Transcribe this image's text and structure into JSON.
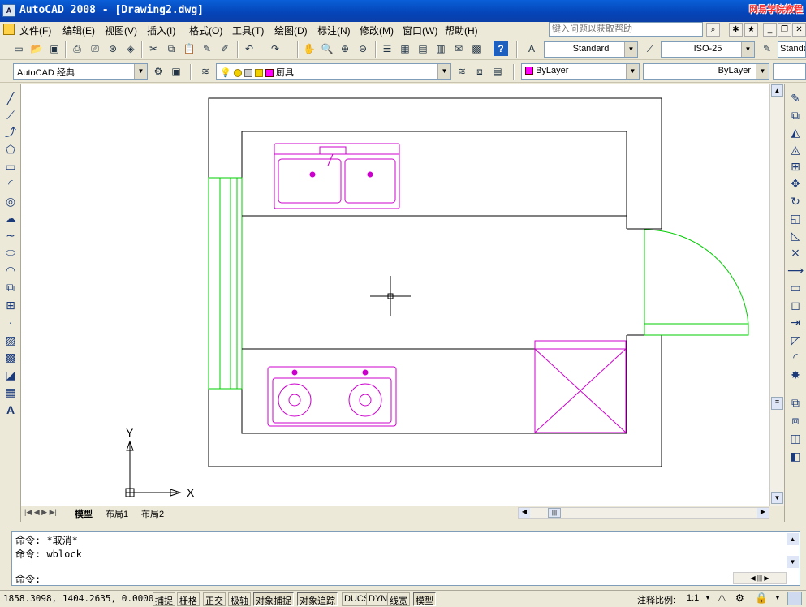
{
  "window": {
    "title": "AutoCAD 2008 - [Drawing2.dwg]",
    "brand": "网易学院教程"
  },
  "menu": {
    "items": [
      "文件(F)",
      "编辑(E)",
      "视图(V)",
      "插入(I)",
      "格式(O)",
      "工具(T)",
      "绘图(D)",
      "标注(N)",
      "修改(M)",
      "窗口(W)",
      "帮助(H)"
    ]
  },
  "help": {
    "placeholder": "键入问题以获取帮助"
  },
  "styles": {
    "text_style": "Standard",
    "dim_style": "ISO-25",
    "table_style": "Standard"
  },
  "workspace": {
    "name": "AutoCAD 经典"
  },
  "layer": {
    "name": "厨具"
  },
  "properties": {
    "color": "ByLayer",
    "linetype": "ByLayer"
  },
  "canvas": {
    "axis_y": "Y",
    "axis_x": "X"
  },
  "tabs": [
    "模型",
    "布局1",
    "布局2"
  ],
  "command": {
    "lines": [
      "命令: *取消*",
      "命令: wblock"
    ],
    "prompt": "命令:"
  },
  "status": {
    "coords": "1858.3098, 1404.2635, 0.0000",
    "toggles": [
      {
        "label": "捕捉",
        "on": false
      },
      {
        "label": "栅格",
        "on": false
      },
      {
        "label": "正交",
        "on": false
      },
      {
        "label": "极轴",
        "on": false
      },
      {
        "label": "对象捕捉",
        "on": true
      },
      {
        "label": "对象追踪",
        "on": true
      },
      {
        "label": "DUCS",
        "on": false
      },
      {
        "label": "DYN",
        "on": false
      },
      {
        "label": "线宽",
        "on": false
      },
      {
        "label": "模型",
        "on": true
      }
    ],
    "scale_label": "注释比例:",
    "scale_value": "1:1"
  },
  "colors": {
    "door": "#00cc00",
    "fixture": "#cc00cc",
    "titlebar": "#0544b8"
  }
}
